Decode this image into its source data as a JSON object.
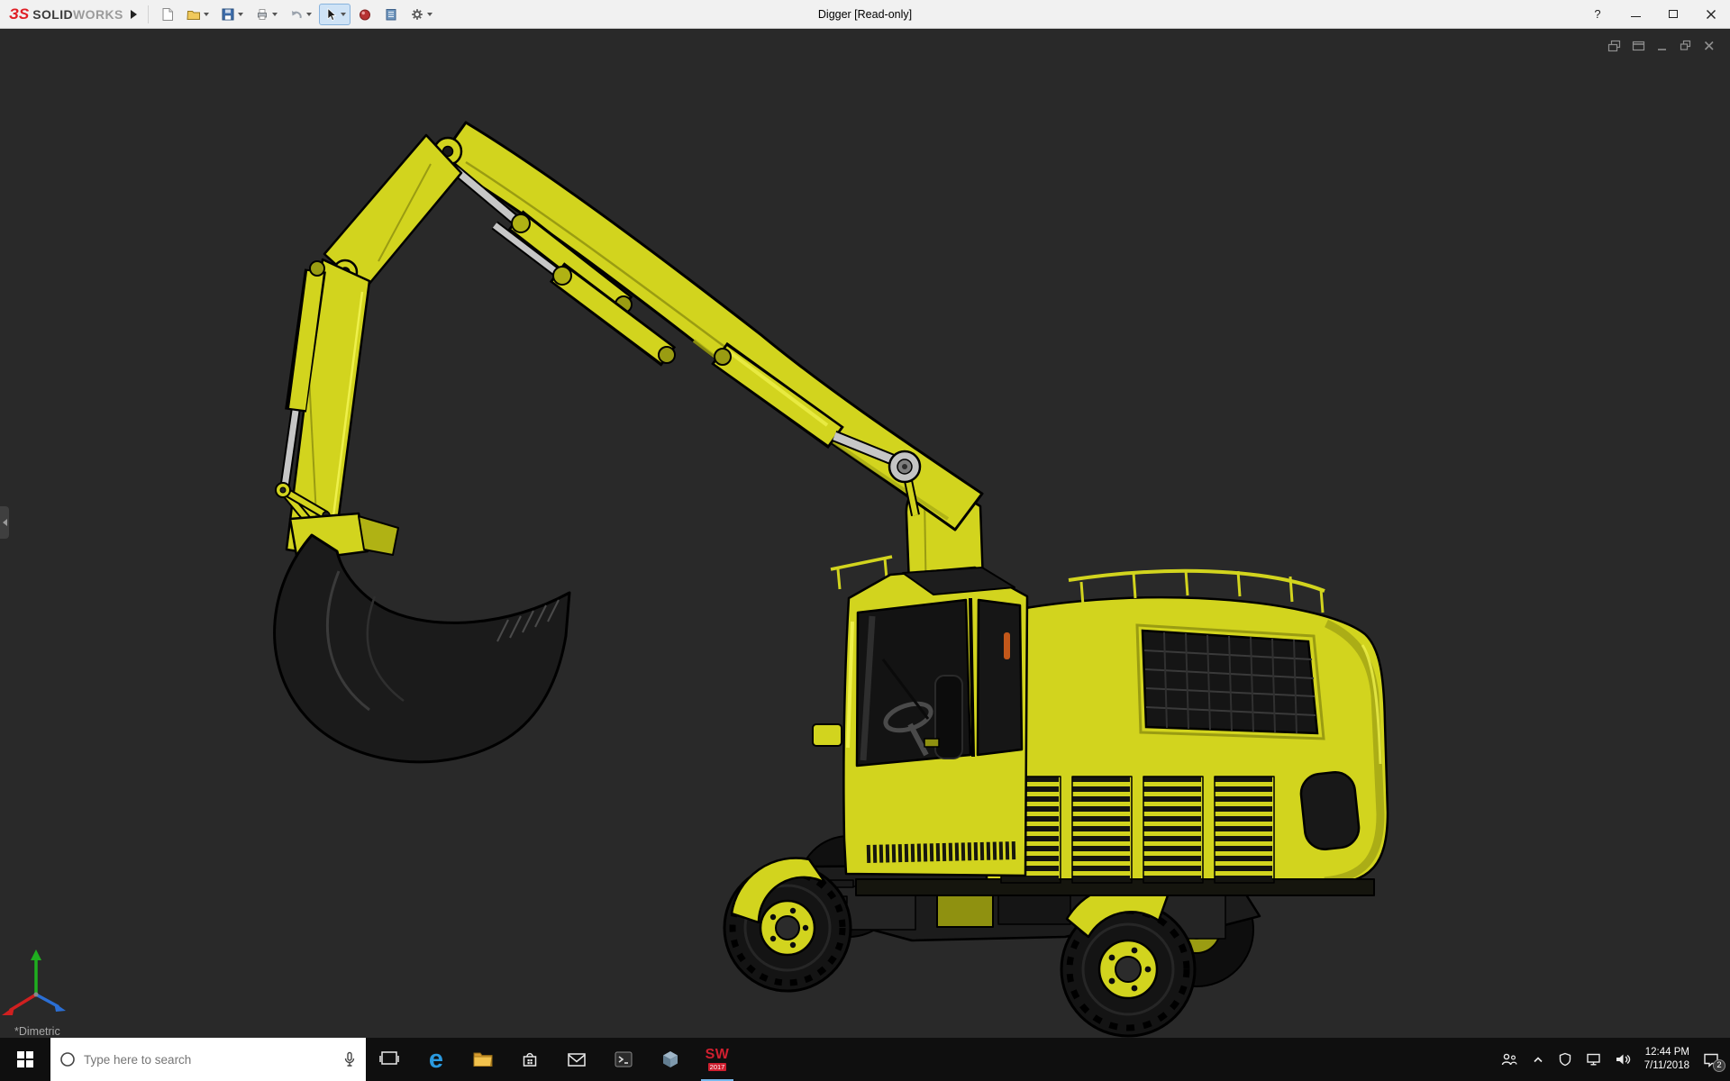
{
  "titlebar": {
    "logo_prefix": "ЗS",
    "logo_solid": "SOLID",
    "logo_works": "WORKS",
    "title": "Digger [Read-only]",
    "help_label": "?",
    "toolbar_icon_names": [
      "new-document-icon",
      "open-icon",
      "save-icon",
      "print-icon",
      "undo-icon",
      "select-cursor-icon",
      "xpress-sphere-icon",
      "design-binder-icon",
      "options-gear-icon"
    ]
  },
  "viewport": {
    "view_orientation_label": "*Dimetric",
    "background_color": "#292929",
    "doc_window_icon_names": [
      "cascade-windows-icon",
      "new-window-icon",
      "minimize-doc-icon",
      "restore-doc-icon",
      "close-doc-icon"
    ]
  },
  "model": {
    "body_color": "#d2d41e",
    "shade_color": "#9a9c12",
    "dark_color": "#1c1c1c",
    "rod_color": "#c6c6c6"
  },
  "taskbar": {
    "search_placeholder": "Type here to search",
    "app_icon_names": [
      "task-view-icon",
      "edge-icon",
      "file-explorer-icon",
      "store-icon",
      "mail-icon",
      "terminal-icon",
      "cube-app-icon",
      "solidworks-icon"
    ],
    "edge_glyph": "e",
    "solidworks_label": "SW",
    "solidworks_year": "2017",
    "tray": {
      "icon_names": [
        "people-icon",
        "hidden-icons-chevron",
        "shield-icon",
        "monitor-icon",
        "speaker-icon",
        "action-center-icon"
      ],
      "time": "12:44 PM",
      "date": "7/11/2018",
      "action_center_badge": "2"
    }
  }
}
